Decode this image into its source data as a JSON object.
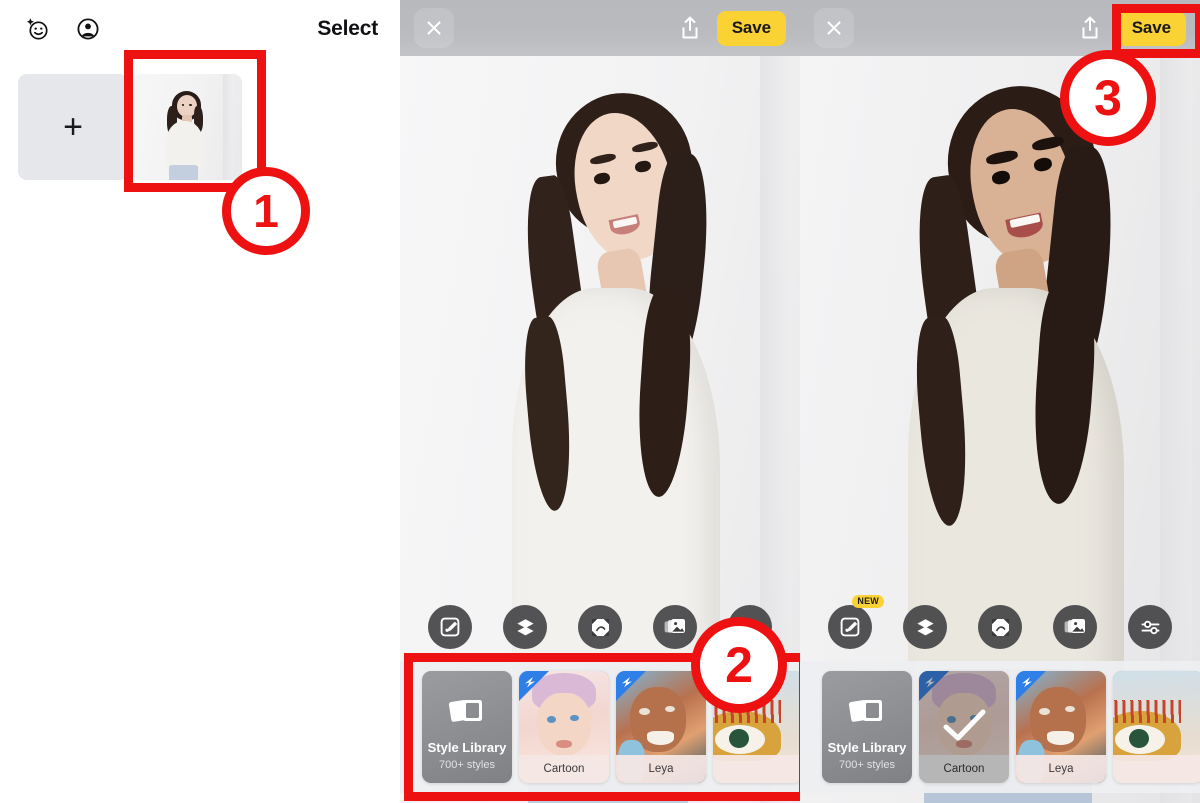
{
  "panel1": {
    "name": "photo-gallery-screen",
    "header": {
      "ai_icon": "ai-smiley-icon",
      "account_icon": "account-circle-icon",
      "select_label": "Select"
    },
    "add_button_glyph": "+",
    "thumbnail_alt": "portrait-photo-thumbnail"
  },
  "panel2": {
    "name": "editor-original-screen",
    "topbar": {
      "close_icon": "close-icon",
      "share_icon": "share-icon",
      "save_label": "Save",
      "save_color": "#fbd233"
    },
    "tools": [
      {
        "name": "retouch-brush-tool",
        "icon": "brush-icon",
        "badge": ""
      },
      {
        "name": "layers-tool",
        "icon": "layers-icon",
        "badge": ""
      },
      {
        "name": "expand-tool",
        "icon": "expand-frame-icon",
        "badge": ""
      },
      {
        "name": "photos-tool",
        "icon": "photos-stack-icon",
        "badge": ""
      },
      {
        "name": "adjust-tool",
        "icon": "sliders-icon",
        "badge": ""
      }
    ],
    "styles": [
      {
        "name": "style-library-card",
        "title": "Style Library",
        "subtitle": "700+ styles",
        "kind": "library",
        "selected": false,
        "pro": false
      },
      {
        "name": "style-card-cartoon",
        "title": "Cartoon",
        "kind": "art",
        "selected": false,
        "pro": true
      },
      {
        "name": "style-card-leya",
        "title": "Leya",
        "kind": "art",
        "selected": false,
        "pro": true
      },
      {
        "name": "style-card-partial",
        "title": "",
        "kind": "art",
        "selected": false,
        "pro": false
      }
    ]
  },
  "panel3": {
    "name": "editor-styled-screen",
    "topbar": {
      "close_icon": "close-icon",
      "share_icon": "share-icon",
      "save_label": "Save",
      "save_color": "#fbd233"
    },
    "tools": [
      {
        "name": "retouch-brush-tool",
        "icon": "brush-icon",
        "badge": "NEW"
      },
      {
        "name": "layers-tool",
        "icon": "layers-icon",
        "badge": ""
      },
      {
        "name": "expand-tool",
        "icon": "expand-frame-icon",
        "badge": ""
      },
      {
        "name": "photos-tool",
        "icon": "photos-stack-icon",
        "badge": ""
      },
      {
        "name": "adjust-tool",
        "icon": "sliders-icon",
        "badge": ""
      }
    ],
    "styles": [
      {
        "name": "style-library-card",
        "title": "Style Library",
        "subtitle": "700+ styles",
        "kind": "library",
        "selected": false,
        "pro": false
      },
      {
        "name": "style-card-cartoon",
        "title": "Cartoon",
        "kind": "art",
        "selected": true,
        "pro": true
      },
      {
        "name": "style-card-leya",
        "title": "Leya",
        "kind": "art",
        "selected": false,
        "pro": true
      },
      {
        "name": "style-card-partial",
        "title": "",
        "kind": "art",
        "selected": false,
        "pro": false
      }
    ]
  },
  "annotations": {
    "accent_color": "#ee1111",
    "steps": [
      {
        "label": "1",
        "target": "photo-thumbnail"
      },
      {
        "label": "2",
        "target": "style-strip"
      },
      {
        "label": "3",
        "target": "save-button"
      }
    ]
  }
}
